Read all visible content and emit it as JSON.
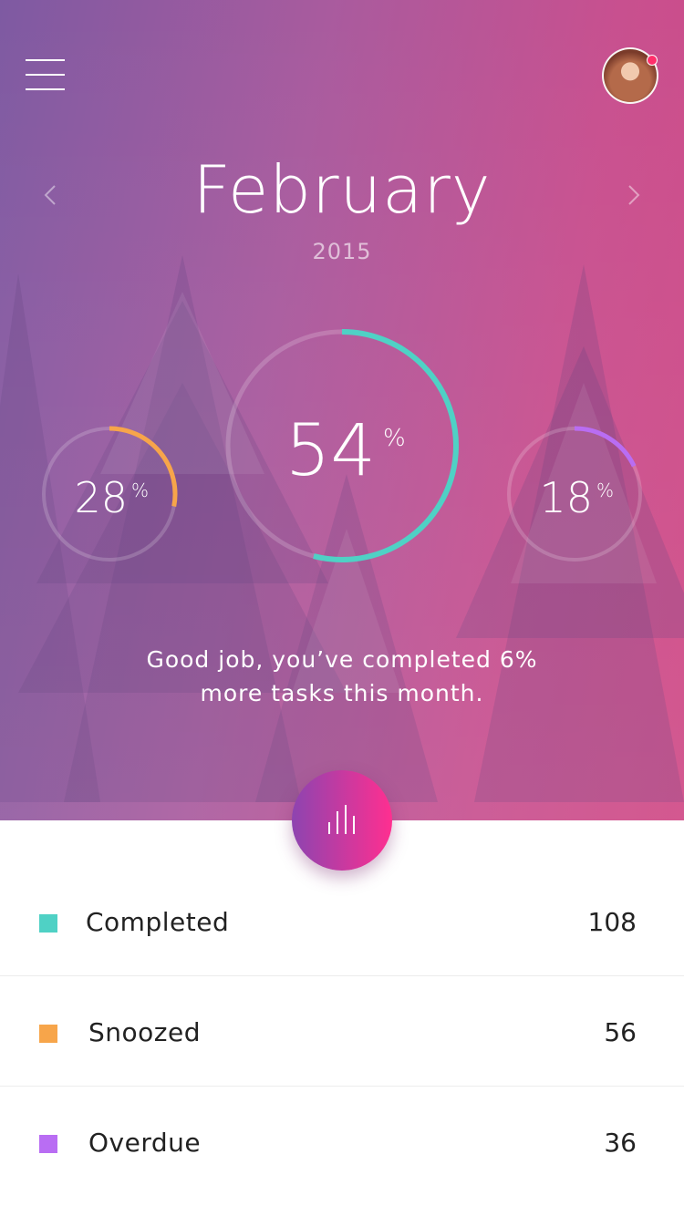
{
  "header": {
    "month": "February",
    "year": "2015",
    "notification_color": "#ff2f6b"
  },
  "icons": {
    "menu": "hamburger-menu-icon",
    "prev": "chevron-left-icon",
    "next": "chevron-right-icon",
    "stats": "bar-chart-icon"
  },
  "stats": {
    "completed": {
      "value": "54",
      "percent_sign": "%",
      "fraction": 0.54,
      "color": "#4fd1c5"
    },
    "snoozed": {
      "value": "28",
      "percent_sign": "%",
      "fraction": 0.28,
      "color": "#f7a54a"
    },
    "overdue": {
      "value": "18",
      "percent_sign": "%",
      "fraction": 0.18,
      "color": "#b96df3"
    }
  },
  "message": {
    "line1": "Good job, you’ve completed 6%",
    "line2": "more tasks this month."
  },
  "legend": [
    {
      "label": "Completed",
      "count": "108",
      "color": "#4fd1c5"
    },
    {
      "label": "Snoozed",
      "count": "56",
      "color": "#f7a54a"
    },
    {
      "label": "Overdue",
      "count": "36",
      "color": "#b96df3"
    }
  ]
}
